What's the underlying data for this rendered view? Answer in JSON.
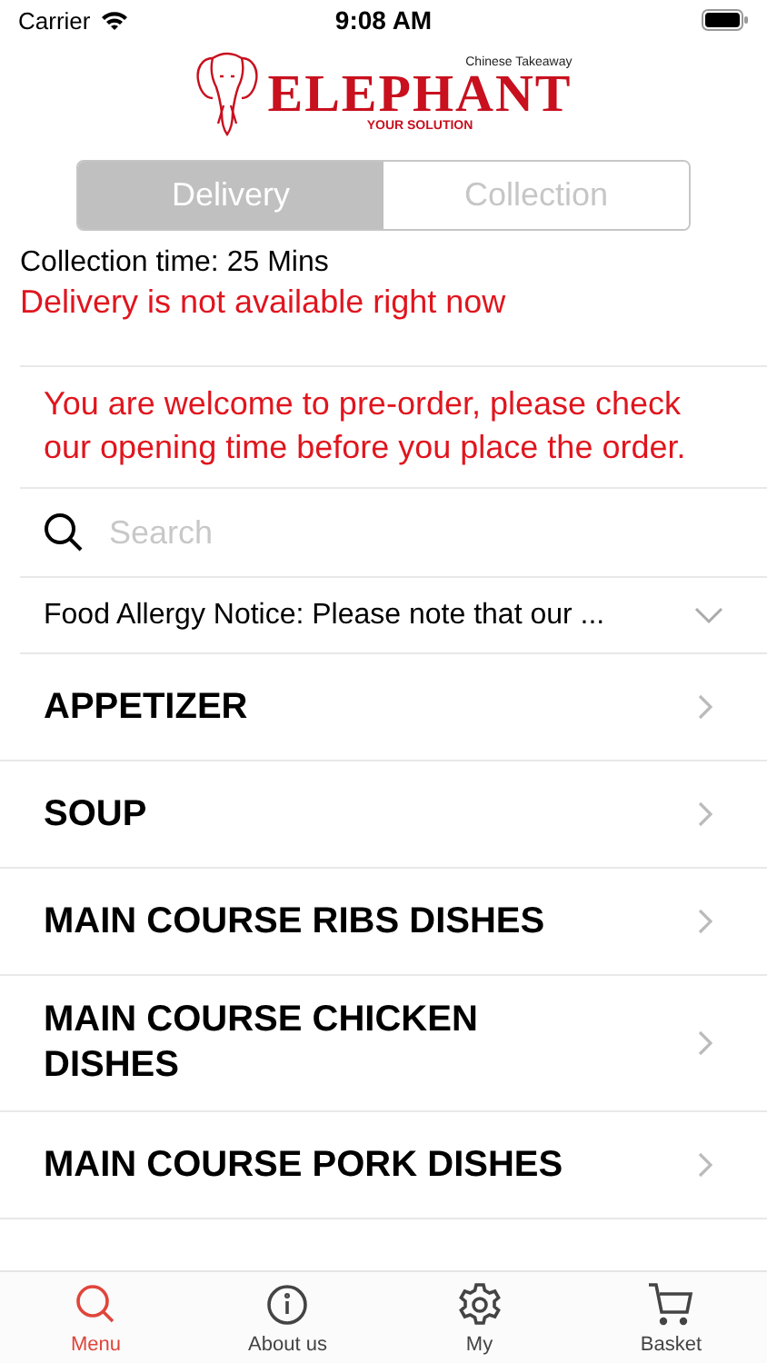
{
  "status_bar": {
    "carrier": "Carrier",
    "time": "9:08 AM"
  },
  "logo": {
    "tagline_top": "Chinese Takeaway",
    "name": "ELEPHANT",
    "tagline_bottom": "YOUR SOLUTION"
  },
  "order_type_tabs": [
    {
      "label": "Delivery",
      "selected": true
    },
    {
      "label": "Collection",
      "selected": false
    }
  ],
  "collection_time": "Collection time: 25 Mins",
  "delivery_notice": "Delivery is not available right now",
  "preorder_notice": "You are welcome to pre-order, please check our opening time before you place the order.",
  "search": {
    "placeholder": "Search"
  },
  "allergy_notice": {
    "text": "Food Allergy Notice: Please note that our ...",
    "expanded": false
  },
  "categories": [
    {
      "name": "APPETIZER"
    },
    {
      "name": "SOUP"
    },
    {
      "name": "MAIN COURSE RIBS DISHES"
    },
    {
      "name": "MAIN COURSE CHICKEN DISHES"
    },
    {
      "name": "MAIN COURSE PORK DISHES"
    }
  ],
  "tab_bar": [
    {
      "label": "Menu",
      "kind": "search",
      "selected": true
    },
    {
      "label": "About us",
      "kind": "info",
      "selected": false
    },
    {
      "label": "My",
      "kind": "settings",
      "selected": false
    },
    {
      "label": "Basket",
      "kind": "cart",
      "selected": false
    }
  ]
}
